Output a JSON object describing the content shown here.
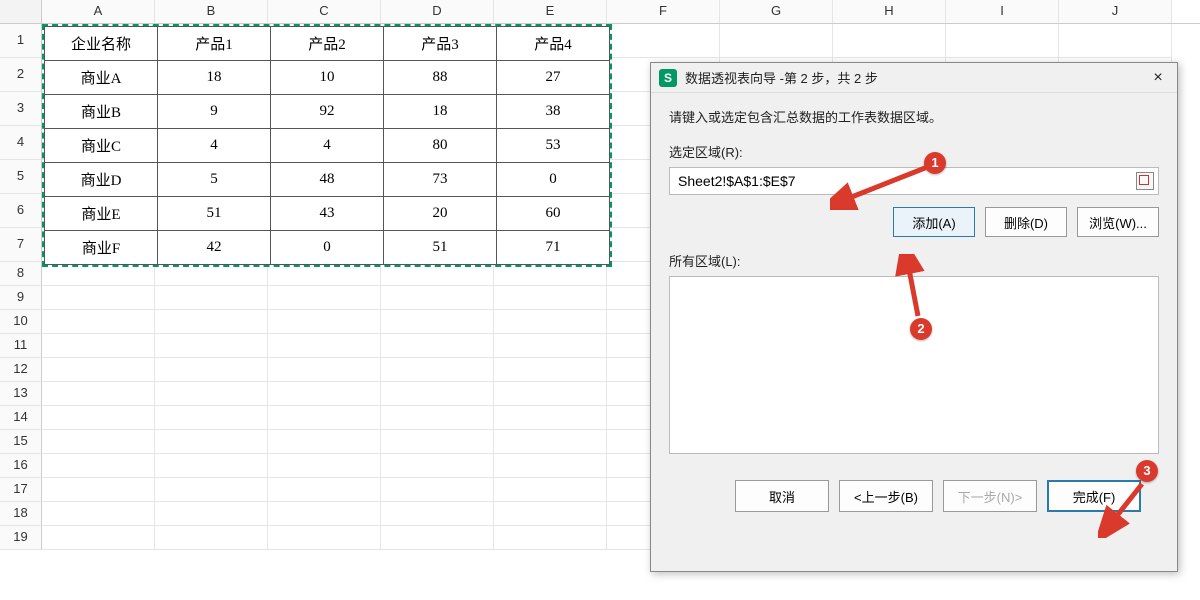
{
  "columns": [
    "A",
    "B",
    "C",
    "D",
    "E",
    "F",
    "G",
    "H",
    "I",
    "J"
  ],
  "data_table": {
    "headers": [
      "企业名称",
      "产品1",
      "产品2",
      "产品3",
      "产品4"
    ],
    "rows": [
      [
        "商业A",
        "18",
        "10",
        "88",
        "27"
      ],
      [
        "商业B",
        "9",
        "92",
        "18",
        "38"
      ],
      [
        "商业C",
        "4",
        "4",
        "80",
        "53"
      ],
      [
        "商业D",
        "5",
        "48",
        "73",
        "0"
      ],
      [
        "商业E",
        "51",
        "43",
        "20",
        "60"
      ],
      [
        "商业F",
        "42",
        "0",
        "51",
        "71"
      ]
    ]
  },
  "dialog": {
    "icon_letter": "S",
    "title": "数据透视表向导 -第 2 步，共 2 步",
    "close_glyph": "×",
    "instruction": "请键入或选定包含汇总数据的工作表数据区域。",
    "range_label": "选定区域(R):",
    "range_value": "Sheet2!$A$1:$E$7",
    "add_btn": "添加(A)",
    "delete_btn": "删除(D)",
    "browse_btn": "浏览(W)...",
    "all_ranges_label": "所有区域(L):",
    "cancel_btn": "取消",
    "back_btn": "<上一步(B)",
    "next_btn": "下一步(N)>",
    "finish_btn": "完成(F)"
  },
  "callouts": {
    "b1": "1",
    "b2": "2",
    "b3": "3"
  }
}
